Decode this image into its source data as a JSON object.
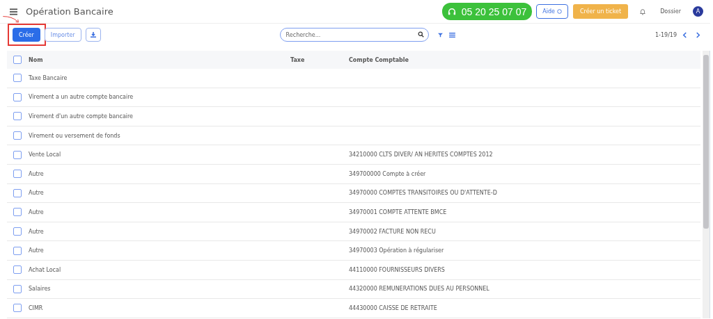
{
  "header": {
    "title": "Opération Bancaire",
    "phone": "05 20 25 07 07",
    "help": "Aide",
    "ticket": "Créer un ticket",
    "dossier": "Dossier",
    "avatar": "A"
  },
  "toolbar": {
    "buttons": [
      {
        "label": "Créer",
        "kind": "primary",
        "annotated": true
      },
      {
        "label": "Importer",
        "kind": "outline"
      },
      {
        "kind": "download"
      }
    ],
    "search": {
      "placeholder": "Recherche..."
    },
    "pager": "1-19/19"
  },
  "table": {
    "columns": [
      "Nom",
      "Taxe",
      "Compte Comptable"
    ],
    "header_checked": false,
    "rows": [
      {
        "nom": "Taxe Bancaire",
        "checked": false
      },
      {
        "nom": "Virement a un autre compte bancaire",
        "checked": false
      },
      {
        "nom": "Virement d'un autre compte bancaire",
        "checked": false
      },
      {
        "nom": "Virement ou versement de fonds",
        "checked": false
      },
      {
        "nom": "Vente Local",
        "compte": "34210000 CLTS DIVER/ AN HERITES COMPTES 2012",
        "checked": false
      },
      {
        "nom": "Autre",
        "compte": "349700000 Compte à créer",
        "checked": false
      },
      {
        "nom": "Autre",
        "compte": "34970000 COMPTES TRANSITOIRES OU D'ATTENTE-D",
        "checked": false
      },
      {
        "nom": "Autre",
        "compte": "34970001 COMPTE ATTENTE BMCE",
        "checked": false
      },
      {
        "nom": "Autre",
        "compte": "34970002 FACTURE NON RECU",
        "checked": false
      },
      {
        "nom": "Autre",
        "compte": "34970003 Opération à régulariser",
        "checked": false
      },
      {
        "nom": "Achat Local",
        "compte": "44110000 FOURNISSEURS DIVERS",
        "checked": false
      },
      {
        "nom": "Salaires",
        "compte": "44320000 REMUNERATIONS DUES AU PERSONNEL",
        "checked": false
      },
      {
        "nom": "CIMR",
        "compte": "44430000 CAISSE DE RETRAITE",
        "checked": false
      }
    ]
  }
}
